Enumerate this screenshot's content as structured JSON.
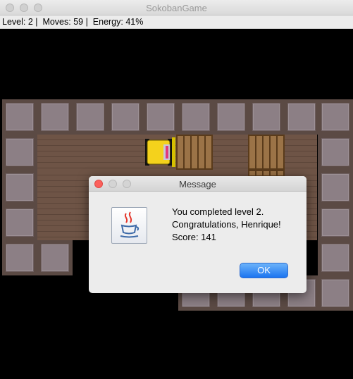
{
  "window": {
    "title": "SokobanGame",
    "traffic_lights": [
      "close",
      "minimize",
      "zoom"
    ]
  },
  "status": {
    "text": "Level: 2 |  Moves: 59 |  Energy: 41%"
  },
  "dialog": {
    "title": "Message",
    "message_lines": [
      "You completed level 2.",
      "Congratulations, Henrique!",
      "Score: 141"
    ],
    "icon": "java-coffee-cup-icon",
    "ok_label": "OK",
    "accent_color": "#1b74f0"
  },
  "board_colors": {
    "background": "#000000",
    "wall": "#8c7f85",
    "floor": "#6e5446",
    "crate": "#9b7347"
  }
}
